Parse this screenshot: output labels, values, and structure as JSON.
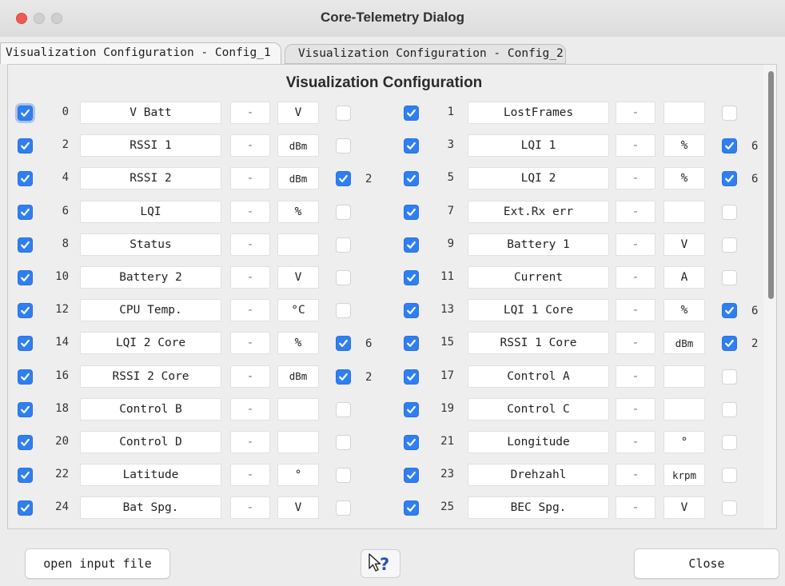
{
  "window": {
    "title": "Core-Telemetry Dialog"
  },
  "tabs": [
    {
      "label": "Visualization Configuration - Config_1",
      "active": true
    },
    {
      "label": "Visualization Configuration - Config_2",
      "active": false
    }
  ],
  "panel": {
    "title": "Visualization Configuration"
  },
  "rows": [
    [
      {
        "checked": true,
        "num": "0",
        "name": "V Batt",
        "dash": "-",
        "unit": "V",
        "sel": false,
        "extra": ""
      },
      {
        "checked": true,
        "num": "1",
        "name": "LostFrames",
        "dash": "-",
        "unit": "",
        "sel": false,
        "extra": ""
      }
    ],
    [
      {
        "checked": true,
        "num": "2",
        "name": "RSSI 1",
        "dash": "-",
        "unit": "dBm",
        "sel": false,
        "extra": ""
      },
      {
        "checked": true,
        "num": "3",
        "name": "LQI 1",
        "dash": "-",
        "unit": "%",
        "sel": true,
        "extra": "6"
      }
    ],
    [
      {
        "checked": true,
        "num": "4",
        "name": "RSSI 2",
        "dash": "-",
        "unit": "dBm",
        "sel": true,
        "extra": "2"
      },
      {
        "checked": true,
        "num": "5",
        "name": "LQI 2",
        "dash": "-",
        "unit": "%",
        "sel": true,
        "extra": "6"
      }
    ],
    [
      {
        "checked": true,
        "num": "6",
        "name": "LQI",
        "dash": "-",
        "unit": "%",
        "sel": false,
        "extra": ""
      },
      {
        "checked": true,
        "num": "7",
        "name": "Ext.Rx err",
        "dash": "-",
        "unit": "",
        "sel": false,
        "extra": ""
      }
    ],
    [
      {
        "checked": true,
        "num": "8",
        "name": "Status",
        "dash": "-",
        "unit": "",
        "sel": false,
        "extra": ""
      },
      {
        "checked": true,
        "num": "9",
        "name": "Battery 1",
        "dash": "-",
        "unit": "V",
        "sel": false,
        "extra": ""
      }
    ],
    [
      {
        "checked": true,
        "num": "10",
        "name": "Battery 2",
        "dash": "-",
        "unit": "V",
        "sel": false,
        "extra": ""
      },
      {
        "checked": true,
        "num": "11",
        "name": "Current",
        "dash": "-",
        "unit": "A",
        "sel": false,
        "extra": ""
      }
    ],
    [
      {
        "checked": true,
        "num": "12",
        "name": "CPU Temp.",
        "dash": "-",
        "unit": "°C",
        "sel": false,
        "extra": ""
      },
      {
        "checked": true,
        "num": "13",
        "name": "LQI 1 Core",
        "dash": "-",
        "unit": "%",
        "sel": true,
        "extra": "6"
      }
    ],
    [
      {
        "checked": true,
        "num": "14",
        "name": "LQI 2 Core",
        "dash": "-",
        "unit": "%",
        "sel": true,
        "extra": "6"
      },
      {
        "checked": true,
        "num": "15",
        "name": "RSSI 1 Core",
        "dash": "-",
        "unit": "dBm",
        "sel": true,
        "extra": "2"
      }
    ],
    [
      {
        "checked": true,
        "num": "16",
        "name": "RSSI 2 Core",
        "dash": "-",
        "unit": "dBm",
        "sel": true,
        "extra": "2"
      },
      {
        "checked": true,
        "num": "17",
        "name": "Control A",
        "dash": "-",
        "unit": "",
        "sel": false,
        "extra": ""
      }
    ],
    [
      {
        "checked": true,
        "num": "18",
        "name": "Control B",
        "dash": "-",
        "unit": "",
        "sel": false,
        "extra": ""
      },
      {
        "checked": true,
        "num": "19",
        "name": "Control C",
        "dash": "-",
        "unit": "",
        "sel": false,
        "extra": ""
      }
    ],
    [
      {
        "checked": true,
        "num": "20",
        "name": "Control D",
        "dash": "-",
        "unit": "",
        "sel": false,
        "extra": ""
      },
      {
        "checked": true,
        "num": "21",
        "name": "Longitude",
        "dash": "-",
        "unit": "°",
        "sel": false,
        "extra": ""
      }
    ],
    [
      {
        "checked": true,
        "num": "22",
        "name": "Latitude",
        "dash": "-",
        "unit": "°",
        "sel": false,
        "extra": ""
      },
      {
        "checked": true,
        "num": "23",
        "name": "Drehzahl",
        "dash": "-",
        "unit": "krpm",
        "sel": false,
        "extra": ""
      }
    ],
    [
      {
        "checked": true,
        "num": "24",
        "name": "Bat Spg.",
        "dash": "-",
        "unit": "V",
        "sel": false,
        "extra": ""
      },
      {
        "checked": true,
        "num": "25",
        "name": "BEC Spg.",
        "dash": "-",
        "unit": "V",
        "sel": false,
        "extra": ""
      }
    ]
  ],
  "buttons": {
    "open_input": "open input file",
    "help_icon": "help-cursor-icon",
    "close": "Close"
  },
  "colors": {
    "checkbox_on": "#2f7ff2",
    "field_bg": "#ffffff",
    "panel_bg": "#eeeeee"
  }
}
